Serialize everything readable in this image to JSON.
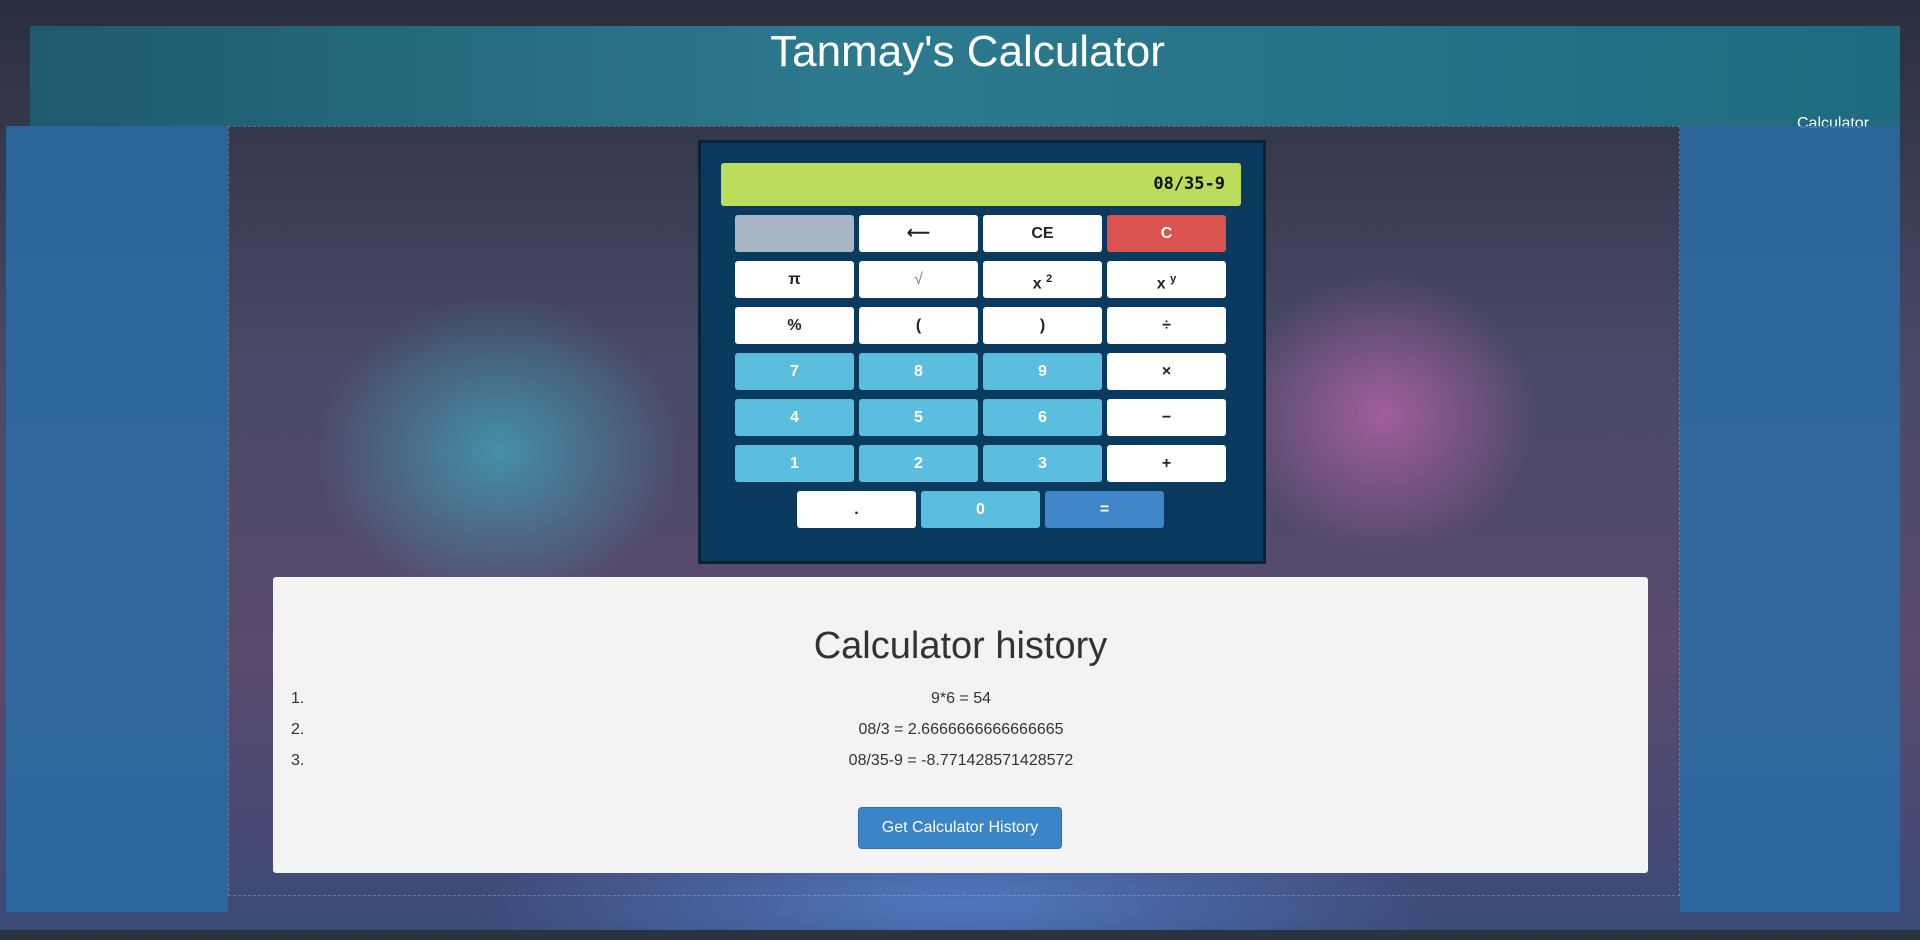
{
  "header": {
    "title": "Tanmay's Calculator",
    "nav_link": "Calculator"
  },
  "calculator": {
    "display_value": "08/35-9",
    "keys": {
      "blank": "",
      "backspace": "⟵",
      "clear_entry": "CE",
      "clear": "C",
      "pi": "π",
      "sqrt": "√",
      "square_base": "x",
      "square_exp": "2",
      "power_base": "x",
      "power_exp": "y",
      "percent": "%",
      "open_paren": "(",
      "close_paren": ")",
      "divide": "÷",
      "seven": "7",
      "eight": "8",
      "nine": "9",
      "multiply": "×",
      "four": "4",
      "five": "5",
      "six": "6",
      "minus": "−",
      "one": "1",
      "two": "2",
      "three": "3",
      "plus": "+",
      "dot": ".",
      "zero": "0",
      "equals": "="
    },
    "colors": {
      "display": "#bcdc5e",
      "panel": "#0a3a5e",
      "digit": "#5bbedf",
      "equals": "#3f85c7",
      "clear": "#d9534f"
    }
  },
  "history": {
    "title": "Calculator history",
    "items": [
      {
        "num": "1.",
        "expr": "9*6 = 54"
      },
      {
        "num": "2.",
        "expr": "08/3 = 2.6666666666666665"
      },
      {
        "num": "3.",
        "expr": "08/35-9 = -8.771428571428572"
      }
    ],
    "button_label": "Get Calculator History"
  }
}
